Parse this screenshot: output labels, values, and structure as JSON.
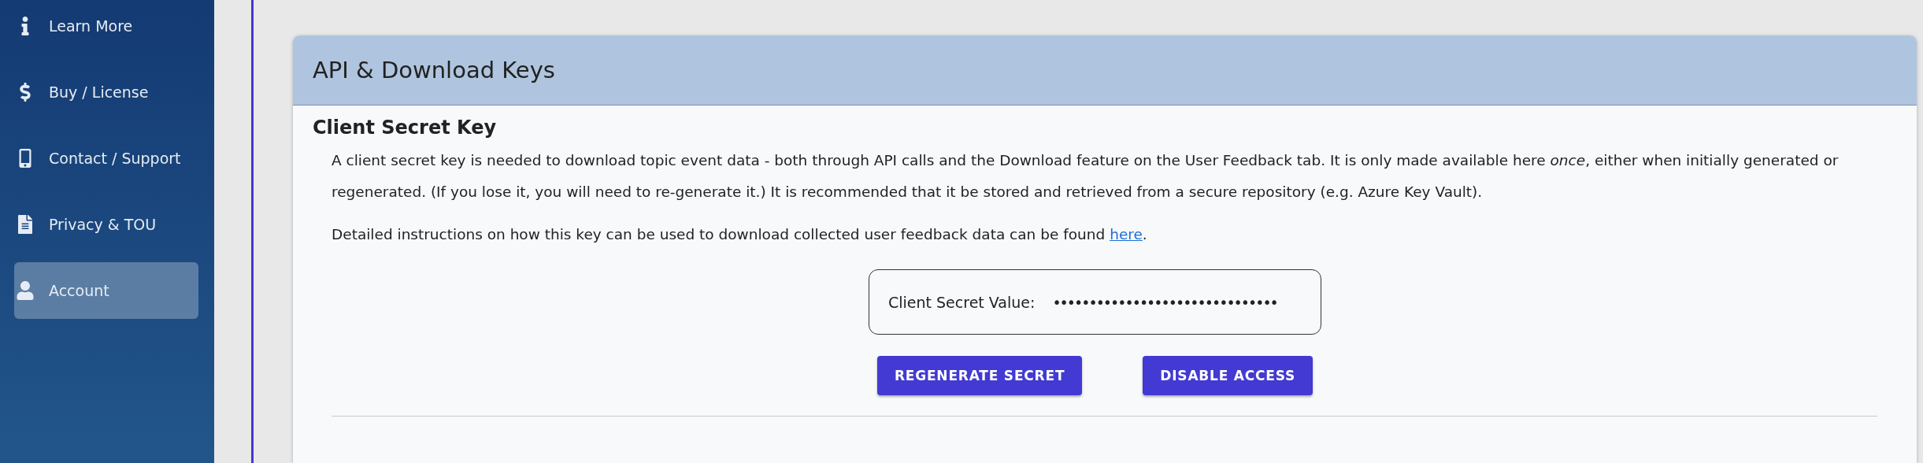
{
  "sidebar": {
    "items": [
      {
        "label": "Learn More",
        "selected": false
      },
      {
        "label": "Buy / License",
        "selected": false
      },
      {
        "label": "Contact / Support",
        "selected": false
      },
      {
        "label": "Privacy & TOU",
        "selected": false
      },
      {
        "label": "Account",
        "selected": true
      }
    ]
  },
  "card": {
    "title": "API & Download Keys",
    "section_title": "Client Secret Key",
    "description": "A client secret key is needed to download topic event data - both through API calls and the Download feature on the User Feedback tab. It is only made available here *once*, either when initially generated or regenerated. (If you lose it, you will need to re-generate it.) It is recommended that it be stored and retrieved from a secure repository (e.g. Azure Key Vault).",
    "instructions": {
      "text": "Detailed instructions on how this key can be used to download collected user feedback data can be found",
      "link": "here",
      "after_link": "."
    },
    "secret": {
      "label": "Client Secret Value:",
      "value": "•••••••••••••••••••••••••••••••"
    },
    "buttons": [
      "REGENERATE SECRET",
      "DISABLE ACCESS"
    ]
  }
}
